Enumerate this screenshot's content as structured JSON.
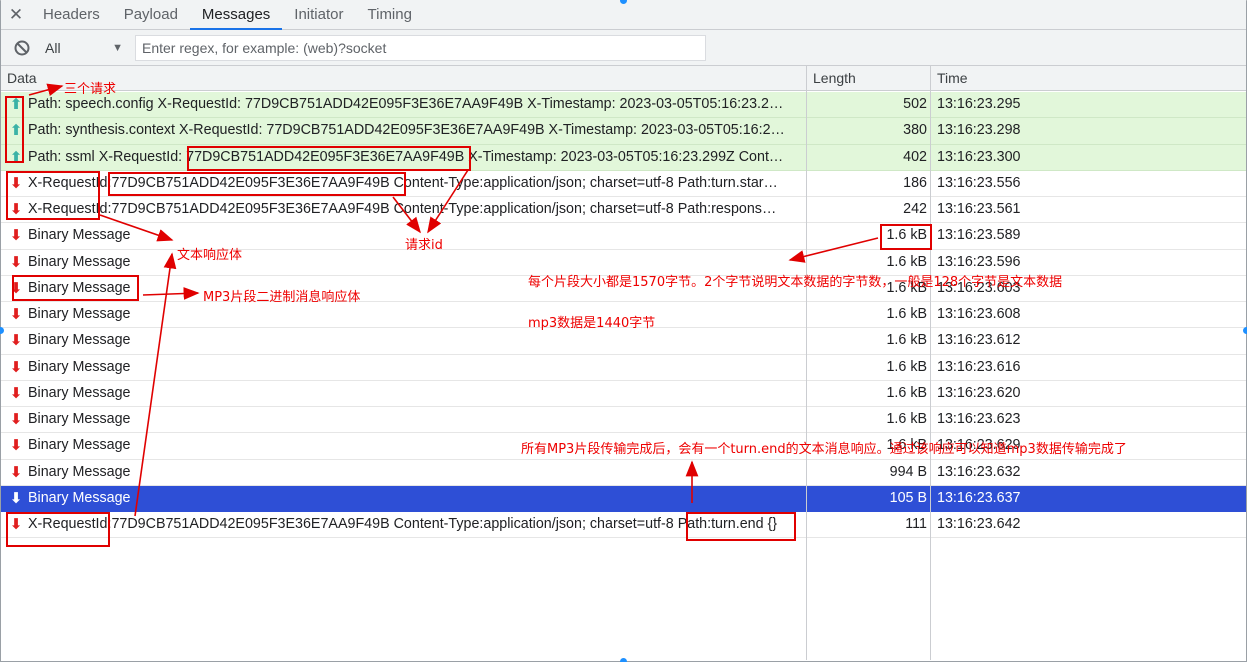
{
  "tabs": [
    {
      "label": "Headers",
      "active": false
    },
    {
      "label": "Payload",
      "active": false
    },
    {
      "label": "Messages",
      "active": true
    },
    {
      "label": "Initiator",
      "active": false
    },
    {
      "label": "Timing",
      "active": false
    }
  ],
  "close_icon": "close-icon",
  "filter": {
    "block_icon": "block-icon",
    "selected": "All",
    "regex_placeholder": "Enter regex, for example: (web)?socket",
    "regex_value": ""
  },
  "table": {
    "headers": {
      "data": "Data",
      "length": "Length",
      "time": "Time"
    },
    "rows": [
      {
        "dir": "up",
        "data": "Path: speech.config X-RequestId: 77D9CB751ADD42E095F3E36E7AA9F49B X-Timestamp: 2023-03-05T05:16:23.2…",
        "length": "502",
        "time": "13:16:23.295"
      },
      {
        "dir": "up",
        "data": "Path: synthesis.context X-RequestId: 77D9CB751ADD42E095F3E36E7AA9F49B X-Timestamp: 2023-03-05T05:16:2…",
        "length": "380",
        "time": "13:16:23.298"
      },
      {
        "dir": "up",
        "data": "Path: ssml X-RequestId: 77D9CB751ADD42E095F3E36E7AA9F49B X-Timestamp: 2023-03-05T05:16:23.299Z Cont…",
        "length": "402",
        "time": "13:16:23.300"
      },
      {
        "dir": "down",
        "data": "X-RequestId:77D9CB751ADD42E095F3E36E7AA9F49B Content-Type:application/json; charset=utf-8 Path:turn.star…",
        "length": "186",
        "time": "13:16:23.556"
      },
      {
        "dir": "down",
        "data": "X-RequestId:77D9CB751ADD42E095F3E36E7AA9F49B Content-Type:application/json; charset=utf-8 Path:respons…",
        "length": "242",
        "time": "13:16:23.561"
      },
      {
        "dir": "down",
        "data": "Binary Message",
        "length": "1.6 kB",
        "time": "13:16:23.589"
      },
      {
        "dir": "down",
        "data": "Binary Message",
        "length": "1.6 kB",
        "time": "13:16:23.596"
      },
      {
        "dir": "down",
        "data": "Binary Message",
        "length": "1.6 kB",
        "time": "13:16:23.603"
      },
      {
        "dir": "down",
        "data": "Binary Message",
        "length": "1.6 kB",
        "time": "13:16:23.608"
      },
      {
        "dir": "down",
        "data": "Binary Message",
        "length": "1.6 kB",
        "time": "13:16:23.612"
      },
      {
        "dir": "down",
        "data": "Binary Message",
        "length": "1.6 kB",
        "time": "13:16:23.616"
      },
      {
        "dir": "down",
        "data": "Binary Message",
        "length": "1.6 kB",
        "time": "13:16:23.620"
      },
      {
        "dir": "down",
        "data": "Binary Message",
        "length": "1.6 kB",
        "time": "13:16:23.623"
      },
      {
        "dir": "down",
        "data": "Binary Message",
        "length": "1.6 kB",
        "time": "13:16:23.629"
      },
      {
        "dir": "down",
        "data": "Binary Message",
        "length": "994 B",
        "time": "13:16:23.632"
      },
      {
        "dir": "down",
        "data": "Binary Message",
        "length": "105 B",
        "time": "13:16:23.637"
      },
      {
        "dir": "down",
        "data": "X-RequestId:77D9CB751ADD42E095F3E36E7AA9F49B Content-Type:application/json; charset=utf-8 Path:turn.end {}",
        "length": "111",
        "time": "13:16:23.642"
      }
    ],
    "selected_row": 15
  },
  "annotations": {
    "three_requests": "三个请求",
    "text_response_body": "文本响应体",
    "request_id": "请求id",
    "mp3_binary_body": "MP3片段二进制消息响应体",
    "segment_size": "每个片段大小都是1570字节。2个字节说明文本数据的字节数，一般是128个字节是文本数据",
    "mp3_size": "mp3数据是1440字节",
    "turn_end": "所有MP3片段传输完成后，会有一个turn.end的文本消息响应。通过该响应可以知道mp3数据传输完成了"
  },
  "colors": {
    "sent_row_bg": "#e2f7da",
    "selected_row_bg": "#2e4fd6",
    "annotation_red": "#ee0000",
    "active_tab_underline": "#1a73e8"
  }
}
